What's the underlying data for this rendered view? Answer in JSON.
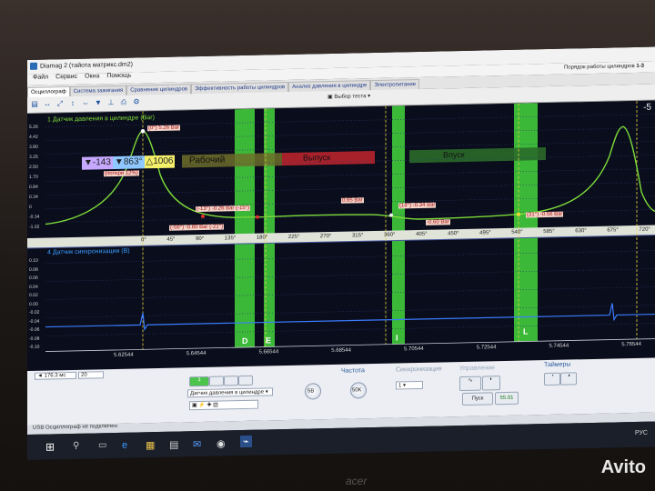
{
  "app": {
    "title": "Diamag 2 (тайота матрикс.dm2)"
  },
  "menu": [
    "Файл",
    "Сервис",
    "Окна",
    "Помощь"
  ],
  "engine_order_label": "Порядок работы цилиндров",
  "engine_order_value": "1-3",
  "tabs": [
    "Осциллограф",
    "Система зажигания",
    "Сравнение цилиндров",
    "Эффективность работы цилиндров",
    "Анализ давления в цилиндре",
    "Электропитание"
  ],
  "toolbar": {
    "test_select": "Выбор теста"
  },
  "channels": {
    "ch1": "1 Датчик давления в цилиндре (Bar)",
    "ch4": "4 Датчик синхронизации (В)"
  },
  "ch1_scale": [
    "5.26",
    "4.42",
    "3.80",
    "3.25",
    "2.50",
    "1.70",
    "0.84",
    "0.34",
    "0",
    "-0.34",
    "-1.02"
  ],
  "ch4_scale": [
    "0.10",
    "0.08",
    "0.06",
    "0.04",
    "0.02",
    "0.00",
    "-0.02",
    "-0.04",
    "-0.06",
    "-0.08",
    "-0.10"
  ],
  "angle_ticks": [
    "0°",
    "45°",
    "90°",
    "135°",
    "180°",
    "225°",
    "270°",
    "315°",
    "360°",
    "405°",
    "450°",
    "495°",
    "540°",
    "585°",
    "630°",
    "675°",
    "720°"
  ],
  "phases": {
    "working": "Рабочий",
    "exhaust": "Выпуск",
    "intake": "Впуск"
  },
  "measure": {
    "a": "-143",
    "b": "863°",
    "c": "1006"
  },
  "annotations": {
    "peak": "(0°) 5.26 Bar",
    "loss": "(потери 12%)",
    "m1": "(-13°) -0.26 Bar (-15°)",
    "m2": "(-56°) -0.60 Bar (-21°)",
    "m3": "0.65 Bar",
    "m4": "(14°) -0.34 Bar",
    "m5": "-0.60 Bar",
    "m6": "(31°) -0.56 Bar"
  },
  "markers": [
    "D",
    "E",
    "I",
    "L"
  ],
  "time_ticks": [
    "5.62544",
    "5.64544",
    "5.66544",
    "5.68544",
    "5.70544",
    "5.72544",
    "5.74544",
    "5.76544"
  ],
  "top_right_value": "-5",
  "bottom": {
    "timebase": "176.3 мс",
    "channel_count": "20",
    "channel_select": "Датчик давления в цилиндре",
    "freq_label": "Частота",
    "sync_label": "Синхронизация",
    "control_label": "Управление",
    "timers_label": "Таймеры",
    "start_btn": "Пуск",
    "freq_display": "55.01",
    "ch_tab_1": "1",
    "sync_value": "1",
    "range_value": "5В",
    "freq_value": "50К",
    "status": "USB Осциллограф не подключен"
  },
  "taskbar": {
    "lang": "РУС"
  },
  "watermark": "Avito",
  "brand": "acer"
}
